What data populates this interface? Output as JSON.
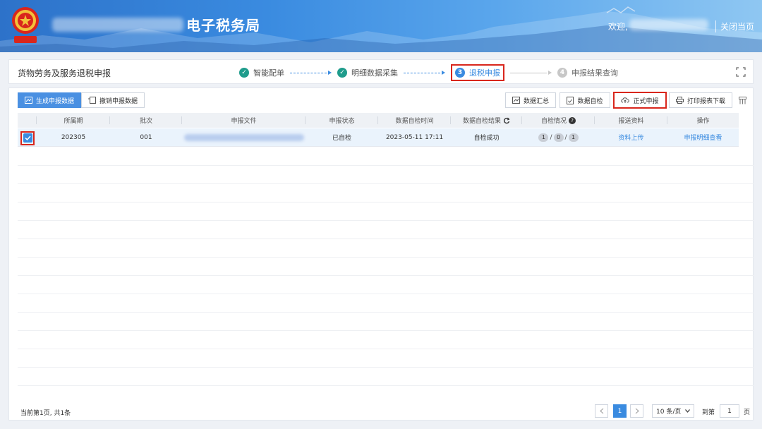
{
  "header": {
    "title": "电子税务局",
    "welcome": "欢迎,",
    "close_page": "关闭当页",
    "brand_color": "#3a8be0"
  },
  "topbar": {
    "page_name": "货物劳务及服务退税申报",
    "steps": [
      {
        "label": "智能配单",
        "status": "done"
      },
      {
        "label": "明细数据采集",
        "status": "done"
      },
      {
        "label": "退税申报",
        "number": "3",
        "status": "current"
      },
      {
        "label": "申报结果查询",
        "number": "4",
        "status": "todo"
      }
    ]
  },
  "toolbar": {
    "generate": "生成申报数据",
    "revoke": "撤销申报数据",
    "summary": "数据汇总",
    "self_check": "数据自检",
    "submit": "正式申报",
    "print": "打印报表下载"
  },
  "table": {
    "headers": [
      "所属期",
      "批次",
      "申报文件",
      "申报状态",
      "数据自检时间",
      "数据自检结果",
      "自检情况",
      "报送资料",
      "操作"
    ],
    "rows": [
      {
        "period": "202305",
        "batch": "001",
        "status": "已自检",
        "check_time": "2023-05-11 17:11",
        "check_result": "自检成功",
        "check_counts": [
          "1",
          "0",
          "1"
        ],
        "upload": "资料上传",
        "action": "申报明细查看"
      }
    ]
  },
  "footer": {
    "info": "当前第1页, 共1条",
    "current_page": "1",
    "page_size": "10 条/页",
    "goto_label": "到第",
    "goto_value": "1",
    "page_suffix": "页"
  }
}
